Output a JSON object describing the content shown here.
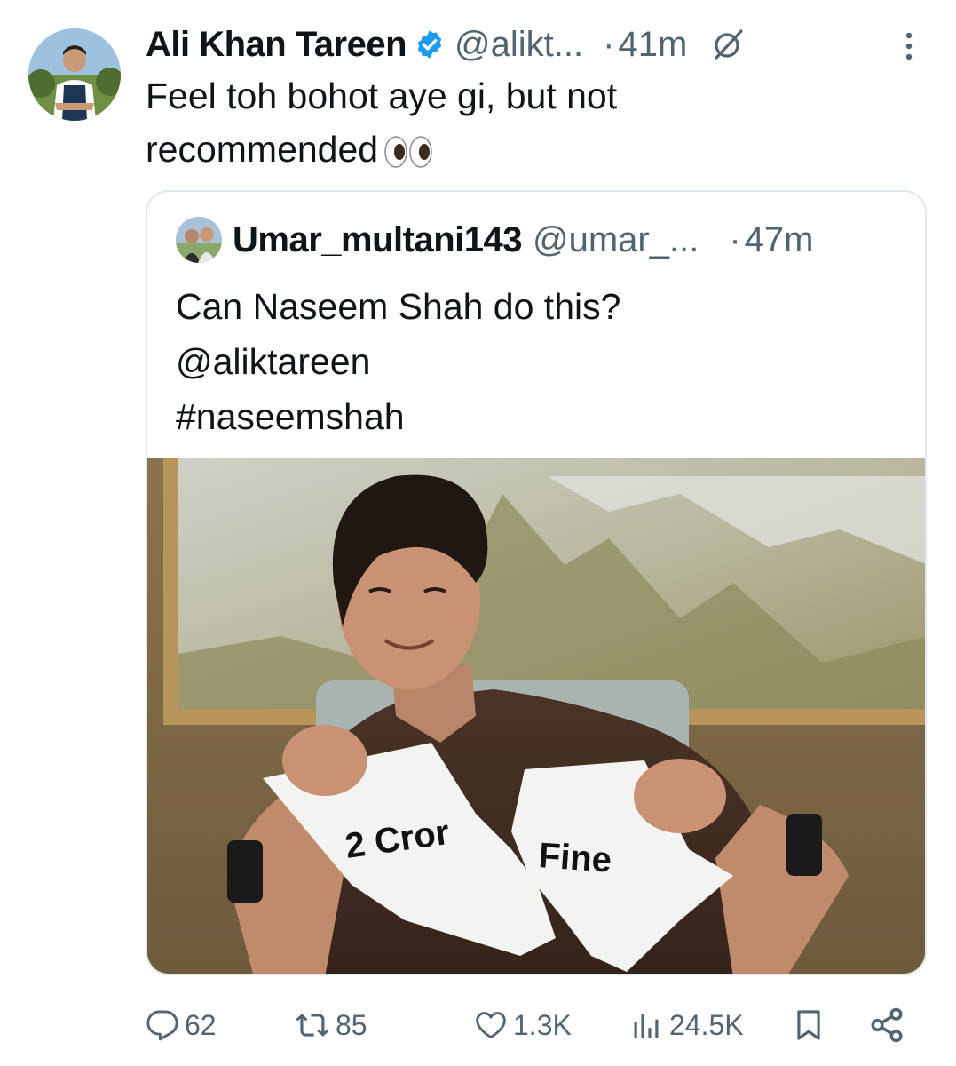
{
  "tweet": {
    "author_name": "Ali Khan Tareen",
    "handle": "@alikt...",
    "time_sep": "·",
    "time": "41m",
    "text_line1": "Feel toh bohot aye gi, but not",
    "text_line2": "recommended"
  },
  "quote": {
    "author_name": "Umar_multani143",
    "handle": "@umar_...",
    "time_sep": "·",
    "time": "47m",
    "line1": "Can Naseem Shah do this?",
    "line2": "@aliktareen",
    "line3": "#naseemshah",
    "image_text_left": "2 Cror",
    "image_text_right": "Fine"
  },
  "actions": {
    "replies": "62",
    "reposts": "85",
    "likes": "1.3K",
    "views": "24.5K"
  },
  "colors": {
    "accent_blue": "#1d9bf0",
    "secondary_text": "#536471",
    "border": "#e1e8ed",
    "primary_text": "#0f1419"
  },
  "icons": [
    "verified-badge-icon",
    "grok-icon",
    "more-icon",
    "eyes-emoji-icon",
    "reply-icon",
    "repost-icon",
    "like-icon",
    "views-icon",
    "bookmark-icon",
    "share-icon"
  ]
}
